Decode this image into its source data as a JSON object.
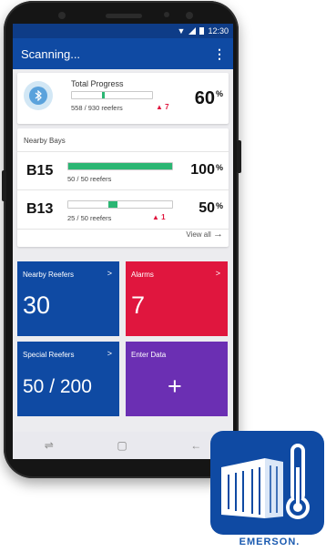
{
  "status_bar": {
    "time": "12:30"
  },
  "app_bar": {
    "title": "Scanning...",
    "menu_icon": "⋮"
  },
  "total_progress": {
    "label": "Total Progress",
    "count_text": "558 / 930 reefers",
    "alarm_count": "7",
    "percent": "60",
    "percent_symbol": "%",
    "progress_fraction": 0.6
  },
  "nearby_bays": {
    "title": "Nearby Bays",
    "bays": [
      {
        "name": "B15",
        "count_text": "50 / 50 reefers",
        "percent": "100",
        "percent_symbol": "%",
        "fraction": 1.0,
        "alarm_count": ""
      },
      {
        "name": "B13",
        "count_text": "25 / 50 reefers",
        "percent": "50",
        "percent_symbol": "%",
        "fraction": 0.5,
        "alarm_count": "1"
      }
    ],
    "view_all": "View all",
    "view_all_arrow": "→"
  },
  "tiles": [
    {
      "label": "Nearby Reefers",
      "value": "30",
      "chevron": ">",
      "color": "#0f4aa3"
    },
    {
      "label": "Alarms",
      "value": "7",
      "chevron": ">",
      "color": "#e0163e"
    },
    {
      "label": "Special Reefers",
      "value": "50 / 200",
      "chevron": ">",
      "color": "#0f4aa3"
    },
    {
      "label": "Enter Data",
      "value": "+",
      "chevron": "",
      "color": "#6b2fb3"
    }
  ],
  "nav_icons": [
    "recent-apps-icon",
    "home-icon",
    "back-icon"
  ],
  "brand": {
    "name": "EMERSON",
    "trademark": ".",
    "color": "#1a5ab0"
  },
  "colors": {
    "primary": "#0f4aa3",
    "statusbar": "#0e3c87",
    "success": "#2bb673",
    "alarm": "#e0163e",
    "purple": "#6b2fb3"
  }
}
